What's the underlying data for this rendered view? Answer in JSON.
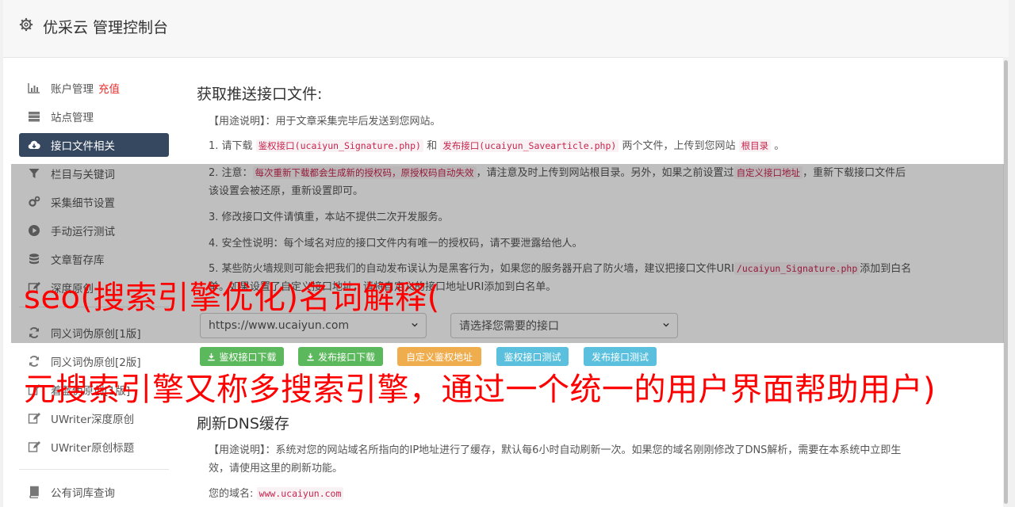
{
  "header": {
    "title": "优采云 管理控制台",
    "icon": "gear-icon"
  },
  "sidebar": {
    "items": [
      {
        "label": "账户管理",
        "extra": "充值",
        "icon": "bar-chart-icon"
      },
      {
        "label": "站点管理",
        "icon": "server-icon"
      },
      {
        "label": "接口文件相关",
        "icon": "cloud-download-icon",
        "active": true
      },
      {
        "label": "栏目与关键词",
        "icon": "filter-icon"
      },
      {
        "label": "采集细节设置",
        "icon": "cogs-icon"
      },
      {
        "label": "手动运行测试",
        "icon": "play-circle-icon"
      },
      {
        "label": "文章暂存库",
        "icon": "database-icon"
      },
      {
        "label": "深度原创",
        "icon": "edit-icon"
      },
      {
        "label": "同义词伪原创[1版]",
        "icon": "refresh-icon"
      },
      {
        "label": "同义词伪原创[2版]",
        "icon": "refresh-icon"
      },
      {
        "label": "着蓝伪原创[1版]",
        "icon": "edit-icon"
      },
      {
        "label": "UWriter深度原创",
        "icon": "edit-icon"
      },
      {
        "label": "UWriter原创标题",
        "icon": "edit-icon"
      },
      {
        "label": "公有词库查询",
        "icon": "book-icon"
      }
    ]
  },
  "main": {
    "section1": {
      "title": "获取推送接口文件:",
      "usage": "【用途说明】：用于文章采集完毕后发送到您网站。",
      "step1": {
        "prefix": "1. 请下载",
        "code_a": "鉴权接口(ucaiyun_Signature.php)",
        "mid": "和",
        "code_b": "发布接口(ucaiyun_Savearticle.php)",
        "suffix_a": "两个文件，上传到您网站",
        "code_c": "根目录",
        "suffix_b": "。"
      },
      "step2": {
        "prefix": "2. 注意：",
        "code_a": "每次重新下载都会生成新的授权码，原授权码自动失效",
        "mid": "，请注意及时上传到网站根目录。另外，如果之前设置过",
        "code_b": "自定义接口地址",
        "suffix": "，重新下载接口文件后该设置会被还原，重新设置即可。"
      },
      "step3": "3. 修改接口文件请慎重，本站不提供二次开发服务。",
      "step4": "4. 安全性说明：每个域名对应的接口文件内有唯一的授权码，请不要泄露给他人。",
      "step5": {
        "prefix": "5. 某些防火墙规则可能会把我们的自动发布误认为是黑客行为，如果您的服务器开启了防火墙，建议把接口文件URI",
        "code": "/ucaiyun_Signature.php",
        "suffix": "添加到白名单。如果设置了自定义接口地址，请将自定义的接口地址URI添加到白名单。"
      },
      "site_select": "https://www.ucaiyun.com",
      "interface_select": "请选择您需要的接口",
      "buttons": {
        "sig_download": "鉴权接口下载",
        "pub_download": "发布接口下载",
        "custom_addr": "自定义鉴权地址",
        "sig_test": "鉴权接口测试",
        "pub_test": "发布接口测试"
      }
    },
    "section2": {
      "title": "刷新DNS缓存",
      "usage": "【用途说明】：系统对您的网站域名所指向的IP地址进行了缓存，默认每6小时自动刷新一次。如果您的域名刚刚修改了DNS解析，需要在本系统中立即生效，请使用这里的刷新功能。",
      "domain_label": "您的域名:",
      "domain_value": "www.ucaiyun.com"
    }
  },
  "overlay": {
    "line1": "seo(搜索引擎优化)名词解释(",
    "line2": "元搜索引擎又称多搜索引擎，通过一个统一的用户界面帮助用户)"
  },
  "colors": {
    "nav_active": "#364860",
    "btn_green": "#5cb85c",
    "btn_orange": "#f0ad4e",
    "btn_blue": "#5bc0de",
    "code_red": "#c7254e",
    "overlay_text": "#ff0000"
  }
}
